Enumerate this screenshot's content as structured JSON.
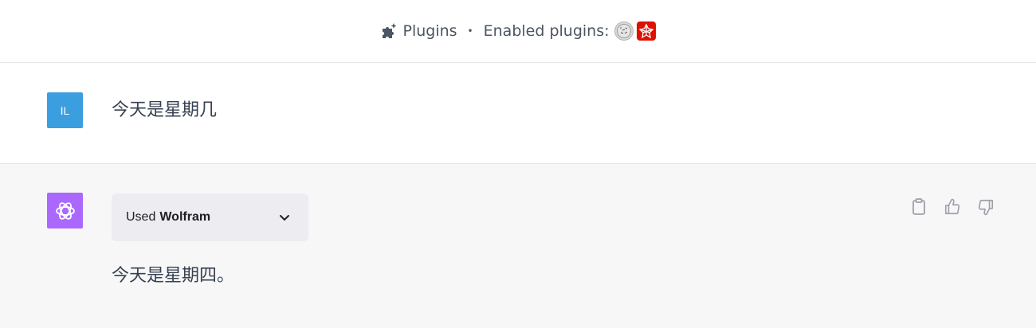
{
  "header": {
    "plugins_label": "Plugins",
    "separator": "•",
    "enabled_label": "Enabled plugins:",
    "enabled_plugins": [
      {
        "name": "Wikipedia",
        "icon": "wikipedia-globe-icon"
      },
      {
        "name": "Wolfram",
        "icon": "wolfram-spikey-icon",
        "color": "#dd1100"
      }
    ]
  },
  "user_message": {
    "avatar_initials": "IL",
    "avatar_color": "#3b9edf",
    "text": "今天是星期几"
  },
  "assistant_message": {
    "avatar_color": "#ab68ff",
    "plugin_used": {
      "prefix": "Used",
      "plugin_name": "Wolfram"
    },
    "text": "今天是星期四。",
    "actions": [
      "copy-icon",
      "thumbs-up-icon",
      "thumbs-down-icon"
    ]
  }
}
